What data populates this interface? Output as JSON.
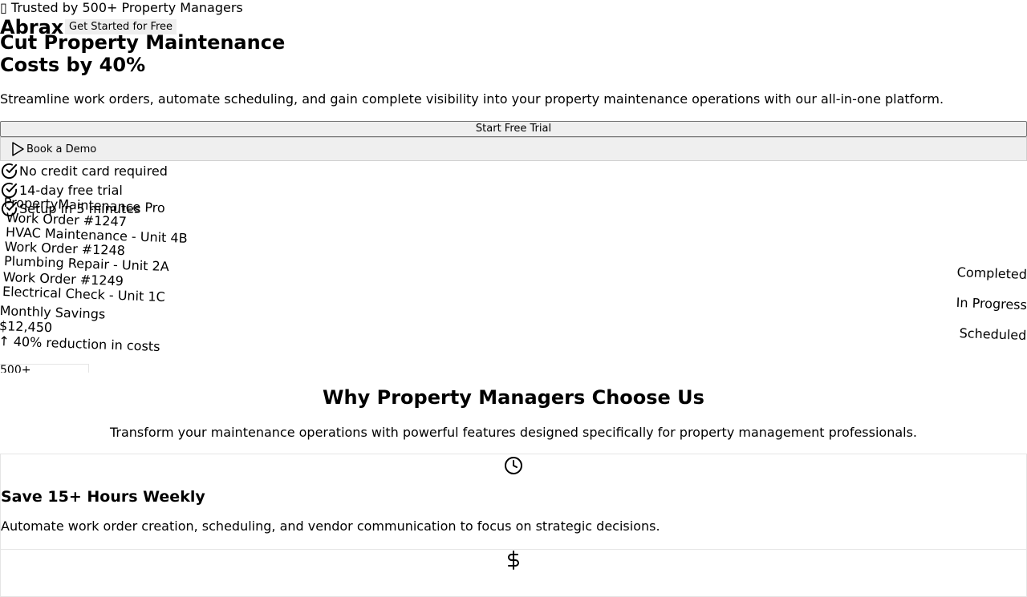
{
  "topbar": {
    "trusted_text": "Trusted by 500+ Property Managers",
    "logo": "Abrax",
    "cta_label": "Get Started for Free"
  },
  "hero": {
    "title_line1": "Cut Property Maintenance",
    "title_line2": "Costs by 40%",
    "subtitle": "Streamline work orders, automate scheduling, and gain complete visibility into your property maintenance operations with our all-in-one platform.",
    "primary_button": "Start Free Trial",
    "secondary_button": "Book a Demo",
    "checks": [
      "No credit card required",
      "14-day free trial",
      "Setup in 5 minutes"
    ]
  },
  "mockup": {
    "app_name": "PropertyMaintenance Pro",
    "work_orders": [
      {
        "id": "Work Order #1247",
        "task": "HVAC Maintenance - Unit 4B",
        "status": "Completed"
      },
      {
        "id": "Work Order #1248",
        "task": "Plumbing Repair - Unit 2A",
        "status": "In Progress"
      },
      {
        "id": "Work Order #1249",
        "task": "Electrical Check - Unit 1C",
        "status": "Scheduled"
      }
    ],
    "savings_label": "Monthly Savings",
    "savings_value": "$12,450",
    "savings_change": "↑ 40% reduction in costs"
  },
  "stats": {
    "first_value": "500+"
  },
  "why": {
    "title": "Why Property Managers Choose Us",
    "subtitle": "Transform your maintenance operations with powerful features designed specifically for property management professionals.",
    "features": [
      {
        "icon": "clock-icon",
        "title": "Save 15+ Hours Weekly",
        "desc": "Automate work order creation, scheduling, and vendor communication to focus on strategic decisions."
      },
      {
        "icon": "dollar-icon"
      }
    ]
  }
}
